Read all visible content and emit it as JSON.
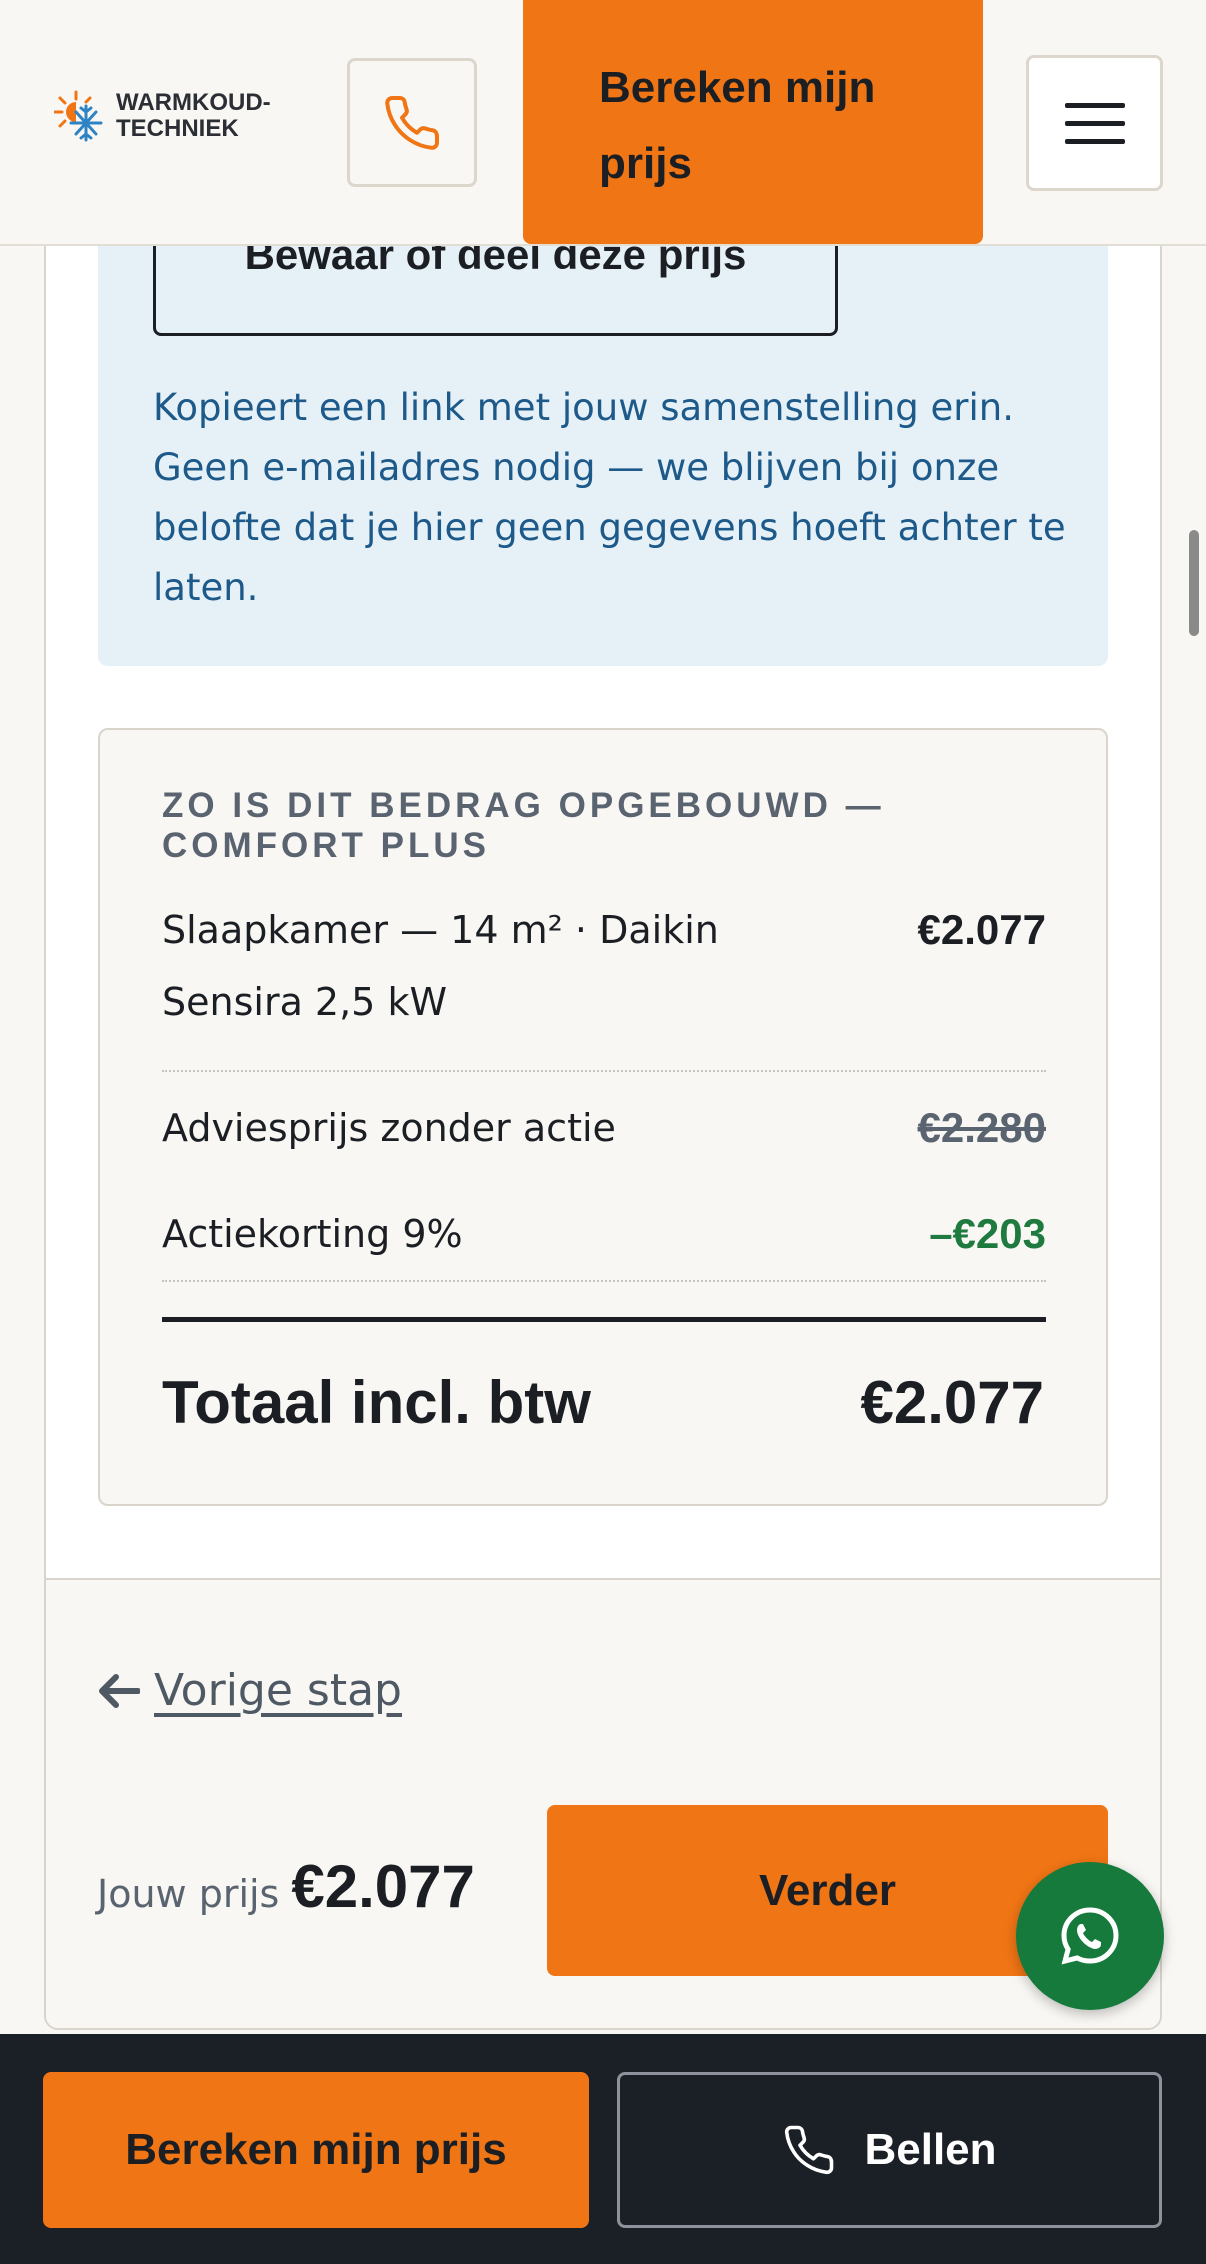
{
  "header": {
    "logo_line1": "WARMKOUD-",
    "logo_line2": "TECHNIEK",
    "cta_label": "Bereken mijn prijs"
  },
  "share": {
    "button_label": "Bewaar of deel deze prijs",
    "description": "Kopieert een link met jouw samenstelling erin. Geen e-mailadres nodig — we blijven bij onze belofte dat je hier geen gegevens hoeft achter te laten."
  },
  "breakdown": {
    "title": "Zo is dit bedrag opgebouwd — Comfort Plus",
    "rows": [
      {
        "label": "Slaapkamer — 14 m² · Daikin Sensira 2,5 kW",
        "amount": "€2.077"
      },
      {
        "label": "Adviesprijs zonder actie",
        "amount": "€2.280"
      },
      {
        "label": "Actiekorting 9%",
        "amount": "–€203"
      }
    ],
    "total_label": "Totaal incl. btw",
    "total_amount": "€2.077"
  },
  "footer": {
    "prev_label": "Vorige stap",
    "price_label": "Jouw prijs",
    "price_value": "€2.077",
    "next_label": "Verder"
  },
  "bottom_bar": {
    "primary_label": "Bereken mijn prijs",
    "call_label": "Bellen"
  },
  "colors": {
    "accent": "#f07515",
    "info_bg": "#e6f0f7",
    "info_text": "#1d5a8a",
    "discount": "#1e7a3e",
    "whatsapp": "#157a3b",
    "dark_bar": "#1b2027"
  },
  "icons": {
    "logo": "sun-snowflake-icon",
    "phone": "phone-icon",
    "menu": "hamburger-menu-icon",
    "back": "arrow-left-icon",
    "whatsapp": "whatsapp-icon"
  }
}
